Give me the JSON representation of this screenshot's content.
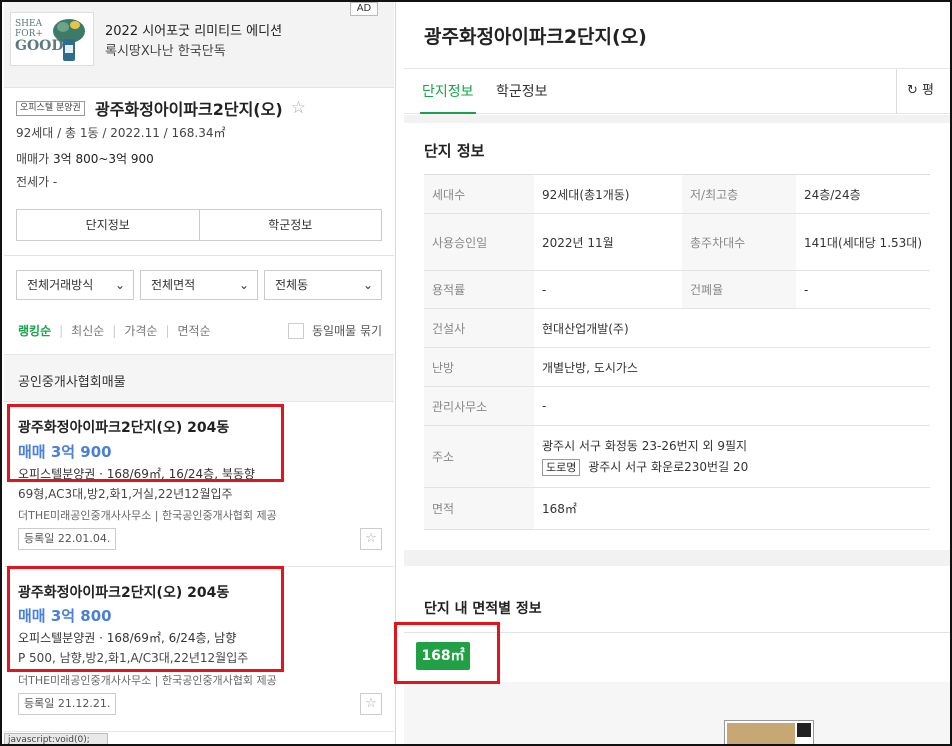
{
  "ad": {
    "badge": "AD",
    "logo_line1": "SHEA",
    "logo_line2": "FOR+",
    "logo_line3": "GOOD",
    "title": "2022 시어포굿 리미티드 에디션",
    "subtitle": "록시땅X나난 한국단독"
  },
  "complex": {
    "type_tag": "오피스텔 분양권",
    "name": "광주화정아이파크2단지(오)",
    "meta": "92세대 / 총 1동 / 2022.11 / 168.34㎡",
    "sale_label": "매매가",
    "sale_value": "3억 800~3억 900",
    "jeonse": "전세가 -",
    "buttons": [
      "단지정보",
      "학군정보"
    ]
  },
  "filters": {
    "trade": "전체거래방식",
    "area": "전체면적",
    "dong": "전체동"
  },
  "sort": {
    "items": [
      "랭킹순",
      "최신순",
      "가격순",
      "면적순"
    ],
    "group_label": "동일매물 묶기"
  },
  "section_band": "공인중개사협회매물",
  "listings": [
    {
      "title": "광주화정아이파크2단지(오) 204동",
      "price": "매매 3억 900",
      "spec": "오피스텔분양권 · 168/69㎡, 16/24층, 북동향",
      "desc": "69형,AC3대,방2,화1,거실,22년12월입주",
      "agent": "더THE미래공인중개사사무소 | 한국공인중개사협회 제공",
      "reg": "등록일 22.01.04."
    },
    {
      "title": "광주화정아이파크2단지(오) 204동",
      "price": "매매 3억 800",
      "spec": "오피스텔분양권 · 168/69㎡, 6/24층, 남향",
      "desc": "P 500, 남향,방2,화1,A/C3대,22년12월입주",
      "agent": "더THE미래공인중개사사무소 | 한국공인중개사협회 제공",
      "reg": "등록일 21.12.21."
    }
  ],
  "status_tip": "javascript:void(0);",
  "right": {
    "title": "광주화정아이파크2단지(오)",
    "tabs": [
      "단지정보",
      "학군정보"
    ],
    "refresh": "평",
    "section_title": "단지 정보",
    "rows": [
      {
        "k1": "세대수",
        "v1": "92세대(총1개동)",
        "k2": "저/최고층",
        "v2": "24층/24층"
      },
      {
        "k1": "사용승인일",
        "v1": "2022년 11월",
        "k2": "총주차대수",
        "v2": "141대(세대당 1.53대)"
      },
      {
        "k1": "용적률",
        "v1": "-",
        "k2": "건폐율",
        "v2": "-"
      },
      {
        "k1": "건설사",
        "v1": "현대산업개발(주)"
      },
      {
        "k1": "난방",
        "v1": "개별난방, 도시가스"
      },
      {
        "k1": "관리사무소",
        "v1": "-"
      },
      {
        "k1": "주소",
        "v1": "광주시 서구 화정동 23-26번지 외 9필지",
        "road_tag": "도로명",
        "road": "광주시 서구 화운로230번길 20"
      },
      {
        "k1": "면적",
        "v1": "168㎡"
      }
    ],
    "area_section_title": "단지 내 면적별 정보",
    "area_chip": "168㎡"
  },
  "colors": {
    "accent_green": "#16a34a",
    "price_blue": "#4a7fd6",
    "highlight_red": "#e2141d",
    "chip_green": "#22a045"
  }
}
